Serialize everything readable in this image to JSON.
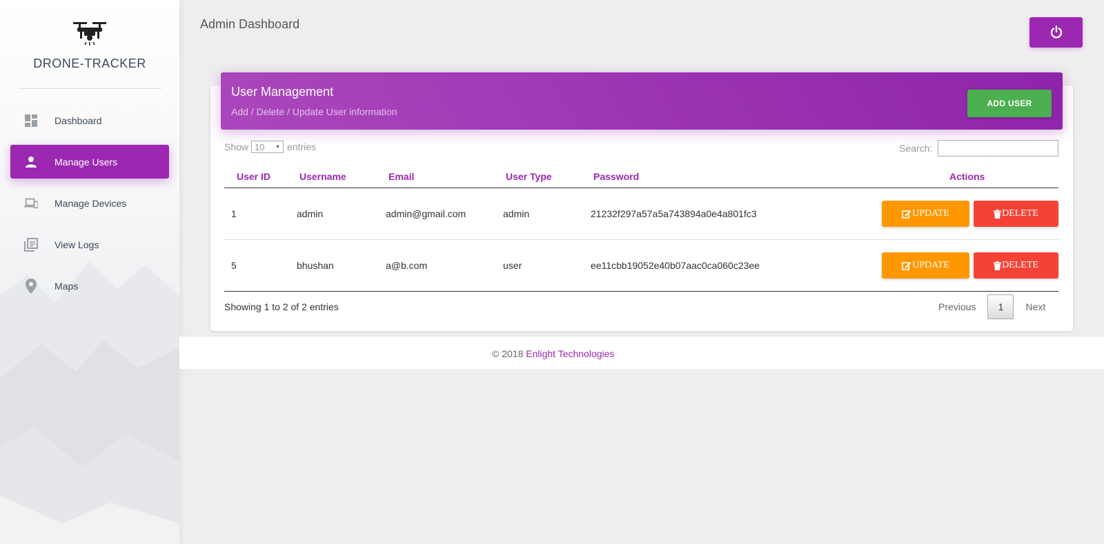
{
  "app": {
    "name": "DRONE-TRACKER"
  },
  "header": {
    "title": "Admin Dashboard"
  },
  "sidebar": {
    "items": [
      {
        "label": "Dashboard",
        "icon": "dashboard-icon",
        "active": false
      },
      {
        "label": "Manage Users",
        "icon": "person-icon",
        "active": true
      },
      {
        "label": "Manage Devices",
        "icon": "devices-icon",
        "active": false
      },
      {
        "label": "View Logs",
        "icon": "library-books-icon",
        "active": false
      },
      {
        "label": "Maps",
        "icon": "location-pin-icon",
        "active": false
      }
    ]
  },
  "card": {
    "title": "User Management",
    "subtitle": "Add / Delete / Update User information",
    "add_button": "ADD USER"
  },
  "table_controls": {
    "show_label": "Show",
    "entries_value": "10",
    "entries_label": "entries",
    "search_label": "Search:",
    "search_value": ""
  },
  "table": {
    "columns": [
      "User ID",
      "Username",
      "Email",
      "User Type",
      "Password",
      "Actions"
    ],
    "rows": [
      {
        "id": "1",
        "username": "admin",
        "email": "admin@gmail.com",
        "type": "admin",
        "password": "21232f297a57a5a743894a0e4a801fc3"
      },
      {
        "id": "5",
        "username": "bhushan",
        "email": "a@b.com",
        "type": "user",
        "password": "ee11cbb19052e40b07aac0ca060c23ee"
      }
    ],
    "update_label": "UPDATE",
    "delete_label": "DELETE"
  },
  "pagination": {
    "info": "Showing 1 to 2 of 2 entries",
    "previous": "Previous",
    "current_page": "1",
    "next": "Next"
  },
  "footer": {
    "copyright": "© 2018",
    "company": "Enlight Technologies"
  },
  "colors": {
    "primary": "#9c27b0",
    "success": "#4caf50",
    "warning": "#ff9800",
    "danger": "#f44336"
  }
}
